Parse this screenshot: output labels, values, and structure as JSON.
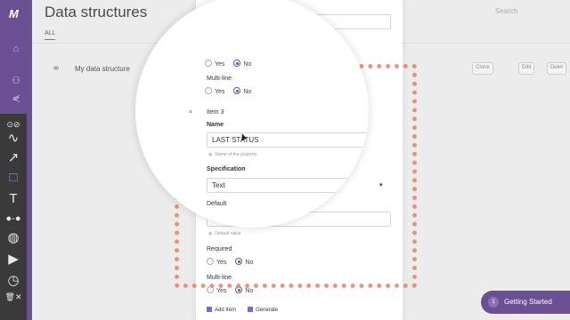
{
  "app": {
    "logo": "M",
    "title": "Data structures",
    "search_label": "Search"
  },
  "tabs": [
    {
      "label": "ALL"
    }
  ],
  "data_structure": {
    "name": "My data structure"
  },
  "actions": {
    "clone": "Clone",
    "edit": "Edit",
    "delete": "Delet"
  },
  "modal": {
    "default_label": "Default",
    "default_hint": "Default value",
    "required_label": "Required",
    "multiline_label": "Multi-line",
    "yes": "Yes",
    "no": "No",
    "item_label": "Item 3",
    "close_glyph": "×",
    "name_label": "Name",
    "name_value": "LAST STATUS",
    "name_hint": "Name of the property.",
    "spec_label": "Specification",
    "spec_value": "Text",
    "add_item": "Add Item",
    "generate": "Generate"
  },
  "getting_started": {
    "count": "1",
    "label": "Getting Started"
  },
  "colors": {
    "nav": "#6a4f92",
    "highlight": "#e8836a",
    "radio_on": "#6a4f92"
  }
}
